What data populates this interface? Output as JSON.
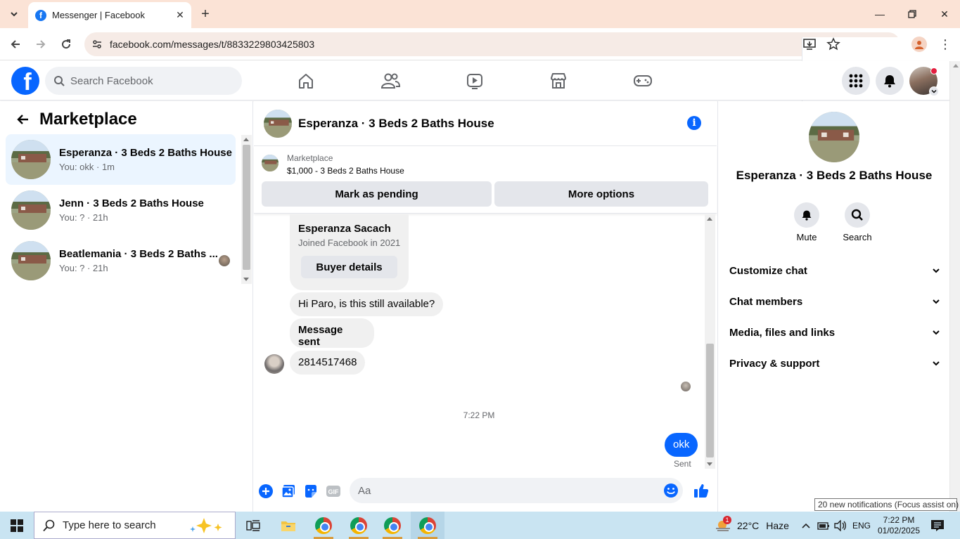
{
  "browser": {
    "tab_title": "Messenger | Facebook",
    "url": "facebook.com/messages/t/8833229803425803"
  },
  "fb": {
    "search_placeholder": "Search Facebook"
  },
  "left": {
    "title": "Marketplace",
    "conversations": [
      {
        "name": "Esperanza · 3 Beds 2 Baths House",
        "preview": "You: okk · 1m"
      },
      {
        "name": "Jenn · 3 Beds 2 Baths House",
        "preview": "You: ? · 21h"
      },
      {
        "name": "Beatlemania · 3 Beds 2 Baths ...",
        "preview": "You: ? · 21h"
      }
    ]
  },
  "chat": {
    "title": "Esperanza · 3 Beds 2 Baths House",
    "listing_label": "Marketplace",
    "listing_price": "$1,000 - 3 Beds 2 Baths House",
    "pending_button": "Mark as pending",
    "more_button": "More options",
    "buyer_name": "Esperanza Sacach",
    "buyer_joined": "Joined Facebook in 2021",
    "buyer_details_button": "Buyer details",
    "messages": [
      {
        "text": "Hi Paro, is this still available?"
      },
      {
        "text": "Message sent"
      },
      {
        "text": "2814517468"
      }
    ],
    "timestamp": "7:22 PM",
    "my_message": "okk",
    "status": "Sent",
    "composer_placeholder": "Aa"
  },
  "right": {
    "name": "Esperanza · 3 Beds 2 Baths House",
    "mute_label": "Mute",
    "search_label": "Search",
    "sections": [
      "Customize chat",
      "Chat members",
      "Media, files and links",
      "Privacy & support"
    ]
  },
  "notification": "20 new notifications (Focus assist on)",
  "taskbar": {
    "search_placeholder": "Type here to search",
    "weather_badge": "1",
    "temperature": "22°C",
    "weather": "Haze",
    "language": "ENG",
    "time": "7:22 PM",
    "date": "01/02/2025"
  },
  "colors": {
    "fb_blue": "#0866ff",
    "active_row": "#ebf5ff",
    "tabbar": "#fbe3d6",
    "taskbar": "#c9e4f2"
  }
}
